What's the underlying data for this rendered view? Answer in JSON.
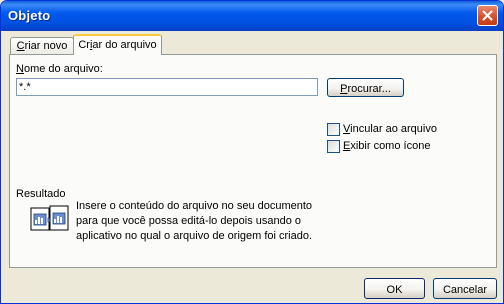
{
  "window": {
    "title": "Objeto"
  },
  "tabs": [
    {
      "label": "Criar novo",
      "mnemonic": "C",
      "rest": "riar novo",
      "active": false
    },
    {
      "label": "Criar do arquivo",
      "mnemonic": "i",
      "pre": "Cr",
      "rest": "ar do arquivo",
      "active": true
    }
  ],
  "file_name": {
    "label": "Nome do arquivo:",
    "label_mnemonic": "N",
    "label_rest": "ome do arquivo:",
    "value": "*.*"
  },
  "browse_button": {
    "label": "Procurar...",
    "mnemonic": "P",
    "rest": "rocurar..."
  },
  "options": [
    {
      "label": "Vincular ao arquivo",
      "mnemonic": "V",
      "rest": "incular ao arquivo",
      "checked": false
    },
    {
      "label": "Exibir como ícone",
      "mnemonic": "E",
      "rest": "xibir como ícone",
      "checked": false
    }
  ],
  "result": {
    "heading": "Resultado",
    "lines": [
      "Insere o conteúdo do arquivo no seu documento",
      "para que você possa editá-lo depois usando o",
      "aplicativo no qual o arquivo de origem foi criado."
    ]
  },
  "footer": {
    "ok_label": "OK",
    "cancel_label": "Cancelar"
  },
  "colors": {
    "title_bar": "#0058ee",
    "dialog_bg": "#ece9d8",
    "panel_bg": "#fbfbf9",
    "active_tab_accent": "#ffc83c"
  },
  "icons": [
    "close-icon",
    "insert-file-result-icon"
  ]
}
